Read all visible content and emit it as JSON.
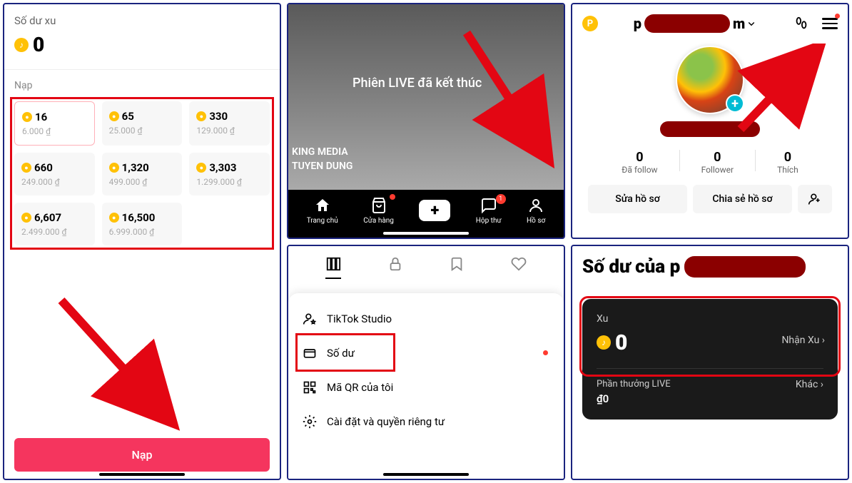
{
  "panel1": {
    "live_ended": "Phiên LIVE đã kết thúc",
    "text1": "KING MEDIA",
    "text2": "TUYEN DUNG",
    "nav": {
      "home": "Trang chủ",
      "shop": "Cửa hàng",
      "inbox": "Hộp thư",
      "inbox_badge": "1",
      "profile": "Hồ sơ"
    }
  },
  "panel2": {
    "badge_letter": "P",
    "name_prefix": "p",
    "name_suffix": "m",
    "stats": {
      "following_num": "0",
      "following_label": "Đã follow",
      "followers_num": "0",
      "followers_label": "Follower",
      "likes_num": "0",
      "likes_label": "Thích"
    },
    "btn_edit": "Sửa hồ sơ",
    "btn_share": "Chia sẻ hồ sơ"
  },
  "panel3": {
    "title": "Số dư xu",
    "balance": "0",
    "nap_label": "Nạp",
    "options": [
      {
        "coins": "16",
        "price": "6.000 ₫"
      },
      {
        "coins": "65",
        "price": "25.000 ₫"
      },
      {
        "coins": "330",
        "price": "129.000 ₫"
      },
      {
        "coins": "660",
        "price": "249.000 ₫"
      },
      {
        "coins": "1,320",
        "price": "499.000 ₫"
      },
      {
        "coins": "3,303",
        "price": "1.299.000 ₫"
      },
      {
        "coins": "6,607",
        "price": "2.499.000 ₫"
      },
      {
        "coins": "16,500",
        "price": "6.999.000 ₫"
      }
    ],
    "cta": "Nạp"
  },
  "panel4": {
    "items": {
      "studio": "TikTok Studio",
      "balance": "Số dư",
      "qr": "Mã QR của tôi",
      "settings": "Cài đặt và quyền riêng tư"
    }
  },
  "panel5": {
    "title_prefix": "Số dư của p",
    "xu_label": "Xu",
    "balance": "0",
    "receive": "Nhận Xu",
    "reward_label": "Phần thưởng LIVE",
    "reward_val": "₫0",
    "other": "Khác"
  }
}
